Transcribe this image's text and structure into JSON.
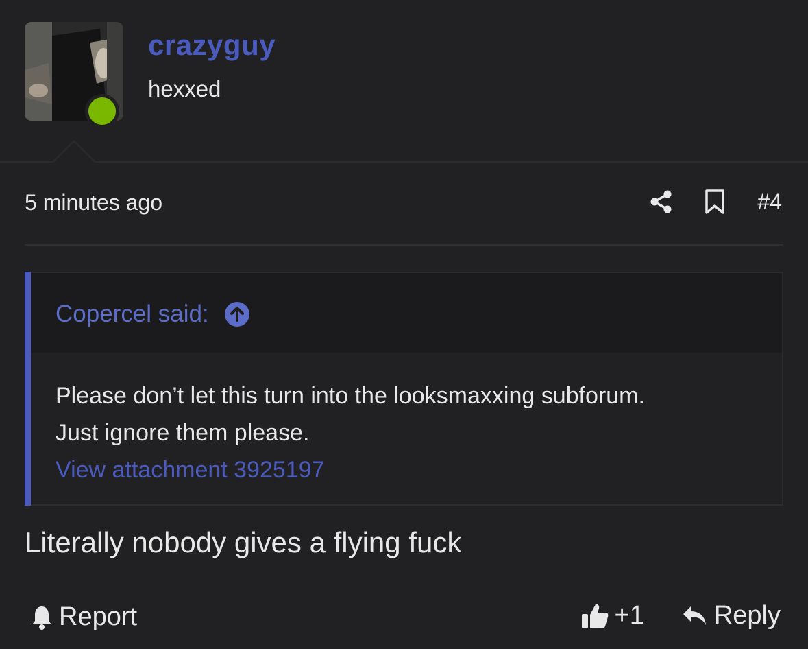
{
  "author": {
    "username": "crazyguy",
    "user_title": "hexxed",
    "online_status_color": "#7ab800",
    "avatar_icon": "avatar-photo"
  },
  "post_meta": {
    "time": "5 minutes ago",
    "share_icon": "share-icon",
    "bookmark_icon": "bookmark-icon",
    "post_number": "#4"
  },
  "quote": {
    "author_label": "Copercel said:",
    "jump_icon": "arrow-up-circle-icon",
    "line1": "Please don’t let this turn into the looksmaxxing subforum.",
    "line2": "Just ignore them please.",
    "attachment_link": "View attachment 3925197"
  },
  "post_body": "Literally nobody gives a flying fuck",
  "footer": {
    "report_label": "Report",
    "like_label": "+1",
    "reply_label": "Reply"
  },
  "colors": {
    "accent": "#4a5bbd",
    "background": "#212123",
    "text": "#e8e8e8"
  }
}
